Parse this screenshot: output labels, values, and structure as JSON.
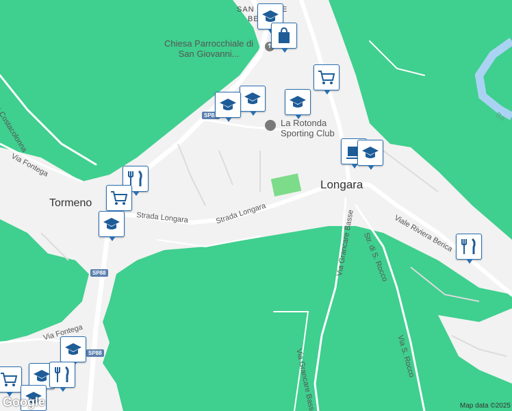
{
  "map": {
    "towns": {
      "tormeno": "Tormeno",
      "longara": "Longara",
      "san_croce_top": "SAN CROCE",
      "san_croce_bottom": "BERICA"
    },
    "streets": {
      "via_costacolonna": "Via Costacolonna",
      "via_fontega_1": "Via Fontega",
      "via_fontega_2": "Via Fontega",
      "strada_longara_1": "Strada Longara",
      "strada_longara_2": "Strada Longara",
      "via_grancare_basse_1": "Via Grancare Basse",
      "via_grancare_basse_2": "Via Grancare Basse",
      "str_di_s_rocco": "Str. di S. Rocco",
      "via_s_rocco": "Via S. Rocco",
      "viale_riviera_berica": "Viale Riviera Berica",
      "ba_partial": "Ba"
    },
    "pois": {
      "chiesa": "Chiesa Parrocchiale di San Giovanni...",
      "chiesa_line1": "Chiesa Parrocchiale di",
      "chiesa_line2": "San Giovanni...",
      "sporting_line1": "La Rotonda",
      "sporting_line2": "Sporting Club"
    },
    "road_shields": [
      "SP88",
      "SP88",
      "SP88"
    ],
    "branding": {
      "logo": "Google",
      "attribution": "Map data ©2025"
    },
    "colors": {
      "land": "#f2f2f2",
      "forest": "#3fcf8e",
      "water": "#aad3f3",
      "park": "#7ddc8a",
      "marker_border": "#2a6fb0",
      "icon": "#1e5c97"
    },
    "markers": [
      "school-icon",
      "shopping-bag-icon",
      "shopping-cart-icon",
      "school-icon",
      "school-icon",
      "school-icon",
      "restaurant-icon",
      "shopping-cart-icon",
      "school-icon",
      "coffee-icon",
      "school-icon",
      "restaurant-icon",
      "school-icon",
      "shopping-cart-icon",
      "school-icon",
      "restaurant-icon",
      "school-icon"
    ]
  }
}
